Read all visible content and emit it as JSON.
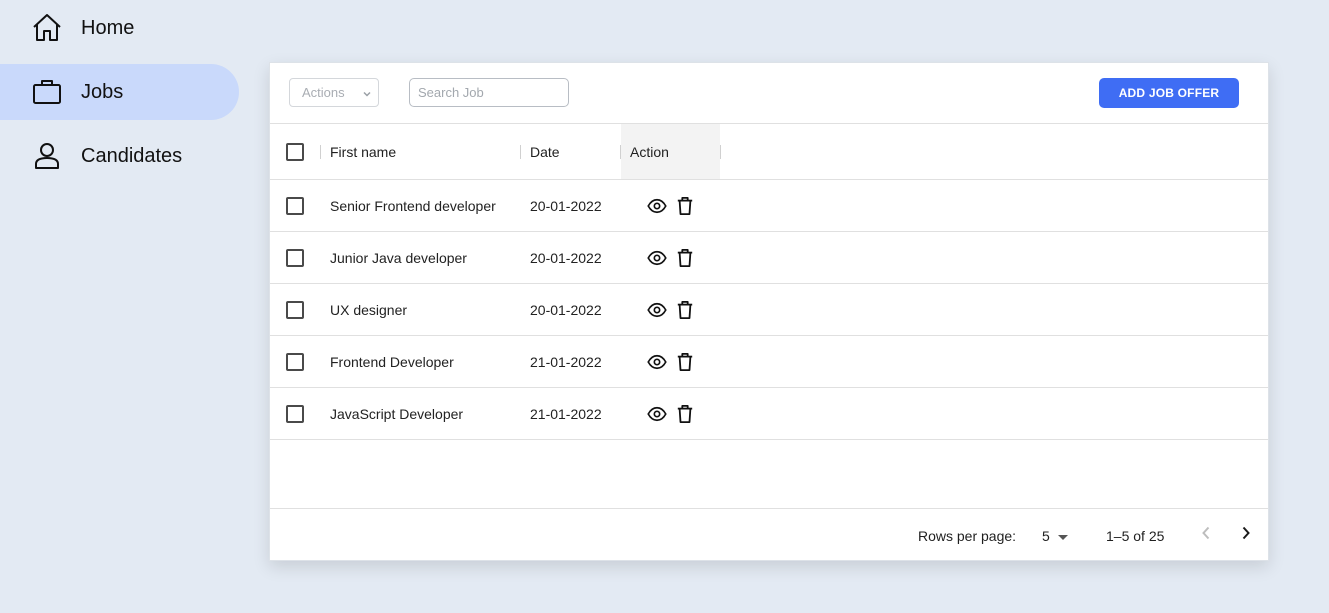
{
  "sidebar": {
    "items": [
      {
        "label": "Home",
        "icon": "home-icon",
        "active": false
      },
      {
        "label": "Jobs",
        "icon": "briefcase-icon",
        "active": true
      },
      {
        "label": "Candidates",
        "icon": "person-icon",
        "active": false
      }
    ]
  },
  "toolbar": {
    "actions_label": "Actions",
    "search_placeholder": "Search Job",
    "add_button_label": "ADD JOB OFFER"
  },
  "table": {
    "columns": [
      "First name",
      "Date",
      "Action"
    ],
    "rows": [
      {
        "name": "Senior Frontend developer",
        "date": "20-01-2022"
      },
      {
        "name": "Junior Java developer",
        "date": "20-01-2022"
      },
      {
        "name": "UX designer",
        "date": "20-01-2022"
      },
      {
        "name": "Frontend Developer",
        "date": "21-01-2022"
      },
      {
        "name": "JavaScript Developer",
        "date": "21-01-2022"
      }
    ]
  },
  "pagination": {
    "rows_per_page_label": "Rows per page:",
    "rows_per_page_value": "5",
    "range_text": "1–5 of 25"
  },
  "colors": {
    "background": "#e3eaf3",
    "active_nav": "#c9d9fb",
    "primary": "#3f6df4"
  }
}
